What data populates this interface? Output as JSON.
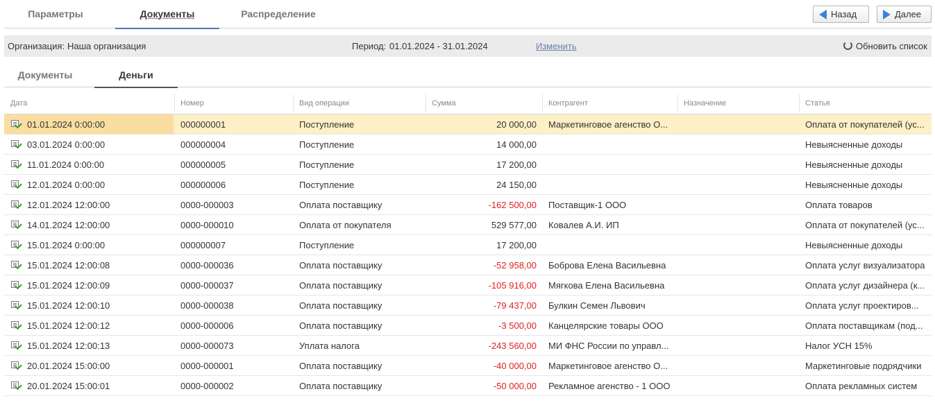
{
  "top_tabs": [
    "Параметры",
    "Документы",
    "Распределение"
  ],
  "buttons": {
    "back": "Назад",
    "next": "Далее"
  },
  "info": {
    "org_label": "Организация:",
    "org_value": "Наша организация",
    "period_label": "Период:",
    "period_value": "01.01.2024 - 31.01.2024",
    "change_link": "Изменить",
    "refresh": "Обновить список"
  },
  "sub_tabs": [
    "Документы",
    "Деньги"
  ],
  "columns": [
    "Дата",
    "Номер",
    "Вид операции",
    "Сумма",
    "Контрагент",
    "Назначение",
    "Статья"
  ],
  "rows": [
    {
      "date": "01.01.2024 0:00:00",
      "number": "000000001",
      "operation": "Поступление",
      "amount": "20 000,00",
      "counterparty": "Маркетинговое агенство О...",
      "purpose": "",
      "article": "Оплата от покупателей (ус..."
    },
    {
      "date": "03.01.2024 0:00:00",
      "number": "000000004",
      "operation": "Поступление",
      "amount": "14 000,00",
      "counterparty": "",
      "purpose": "",
      "article": "Невыясненные доходы"
    },
    {
      "date": "11.01.2024 0:00:00",
      "number": "000000005",
      "operation": "Поступление",
      "amount": "17 200,00",
      "counterparty": "",
      "purpose": "",
      "article": "Невыясненные доходы"
    },
    {
      "date": "12.01.2024 0:00:00",
      "number": "000000006",
      "operation": "Поступление",
      "amount": "24 150,00",
      "counterparty": "",
      "purpose": "",
      "article": "Невыясненные доходы"
    },
    {
      "date": "12.01.2024 12:00:00",
      "number": "0000-000003",
      "operation": "Оплата поставщику",
      "amount": "-162 500,00",
      "counterparty": "Поставщик-1 ООО",
      "purpose": "",
      "article": "Оплата товаров"
    },
    {
      "date": "14.01.2024 12:00:00",
      "number": "0000-000010",
      "operation": "Оплата от покупателя",
      "amount": "529 577,00",
      "counterparty": "Ковалев А.И. ИП",
      "purpose": "",
      "article": "Оплата от покупателей (ус..."
    },
    {
      "date": "15.01.2024 0:00:00",
      "number": "000000007",
      "operation": "Поступление",
      "amount": "17 200,00",
      "counterparty": "",
      "purpose": "",
      "article": "Невыясненные доходы"
    },
    {
      "date": "15.01.2024 12:00:08",
      "number": "0000-000036",
      "operation": "Оплата поставщику",
      "amount": "-52 958,00",
      "counterparty": "Боброва Елена Васильевна",
      "purpose": "",
      "article": "Оплата услуг визуализатора"
    },
    {
      "date": "15.01.2024 12:00:09",
      "number": "0000-000037",
      "operation": "Оплата поставщику",
      "amount": "-105 916,00",
      "counterparty": "Мягкова Елена Васильевна",
      "purpose": "",
      "article": "Оплата услуг дизайнера (к..."
    },
    {
      "date": "15.01.2024 12:00:10",
      "number": "0000-000038",
      "operation": "Оплата поставщику",
      "amount": "-79 437,00",
      "counterparty": "Булкин Семен Львович",
      "purpose": "",
      "article": "Оплата услуг проектиров..."
    },
    {
      "date": "15.01.2024 12:00:12",
      "number": "0000-000006",
      "operation": "Оплата поставщику",
      "amount": "-3 500,00",
      "counterparty": "Канцелярские товары ООО",
      "purpose": "",
      "article": "Оплата поставщикам (под..."
    },
    {
      "date": "15.01.2024 12:00:13",
      "number": "0000-000073",
      "operation": "Уплата налога",
      "amount": "-243 560,00",
      "counterparty": "МИ ФНС России по управл...",
      "purpose": "",
      "article": "Налог УСН 15%"
    },
    {
      "date": "20.01.2024 15:00:00",
      "number": "0000-000001",
      "operation": "Оплата поставщику",
      "amount": "-40 000,00",
      "counterparty": "Маркетинговое агенство О...",
      "purpose": "",
      "article": "Маркетинговые подрядчики"
    },
    {
      "date": "20.01.2024 15:00:01",
      "number": "0000-000002",
      "operation": "Оплата поставщику",
      "amount": "-50 000,00",
      "counterparty": "Рекламное агенство - 1 ООО",
      "purpose": "",
      "article": "Оплата рекламных систем"
    }
  ],
  "colors": {
    "accent": "#4a78b8",
    "negative": "#e02020",
    "selected_row": "#fdf0c6"
  }
}
